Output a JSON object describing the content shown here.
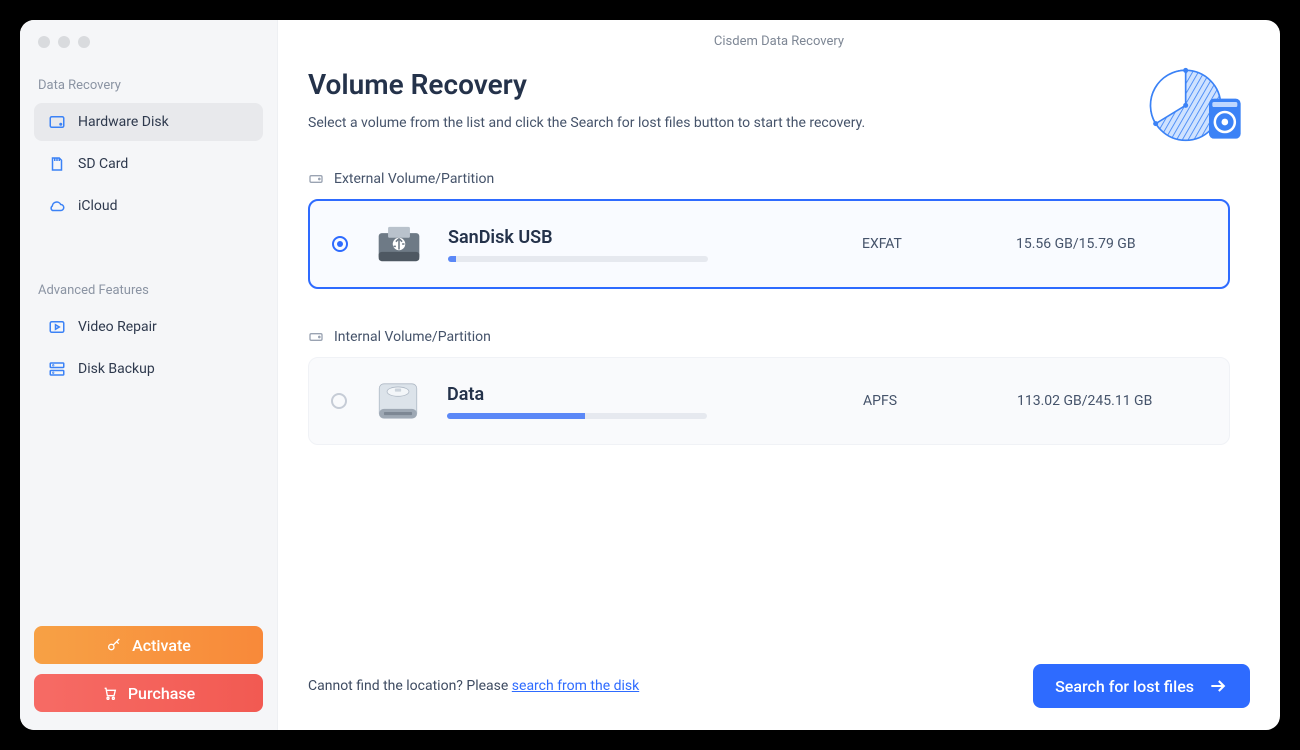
{
  "window": {
    "title": "Cisdem Data Recovery"
  },
  "sidebar": {
    "sections": [
      {
        "label": "Data Recovery",
        "items": [
          {
            "label": "Hardware Disk",
            "icon": "disk-icon",
            "active": true
          },
          {
            "label": "SD Card",
            "icon": "sdcard-icon",
            "active": false
          },
          {
            "label": "iCloud",
            "icon": "cloud-icon",
            "active": false
          }
        ]
      },
      {
        "label": "Advanced Features",
        "items": [
          {
            "label": "Video Repair",
            "icon": "video-icon",
            "active": false
          },
          {
            "label": "Disk Backup",
            "icon": "backup-icon",
            "active": false
          }
        ]
      }
    ],
    "buttons": {
      "activate": "Activate",
      "purchase": "Purchase"
    }
  },
  "page": {
    "title": "Volume Recovery",
    "subtitle": "Select a volume from the list and click the Search for lost files button to start the recovery."
  },
  "groups": [
    {
      "label": "External Volume/Partition",
      "volumes": [
        {
          "name": "SanDisk USB",
          "fs": "EXFAT",
          "size": "15.56 GB/15.79 GB",
          "used_pct": 3,
          "selected": true,
          "kind": "usb"
        }
      ]
    },
    {
      "label": "Internal Volume/Partition",
      "volumes": [
        {
          "name": "Data",
          "fs": "APFS",
          "size": "113.02 GB/245.11 GB",
          "used_pct": 53,
          "selected": false,
          "kind": "hdd"
        }
      ]
    }
  ],
  "footer": {
    "hint_prefix": "Cannot find the location? Please ",
    "hint_link": "search from the disk",
    "search_button": "Search for lost files"
  },
  "colors": {
    "accent": "#2E6BFF"
  }
}
